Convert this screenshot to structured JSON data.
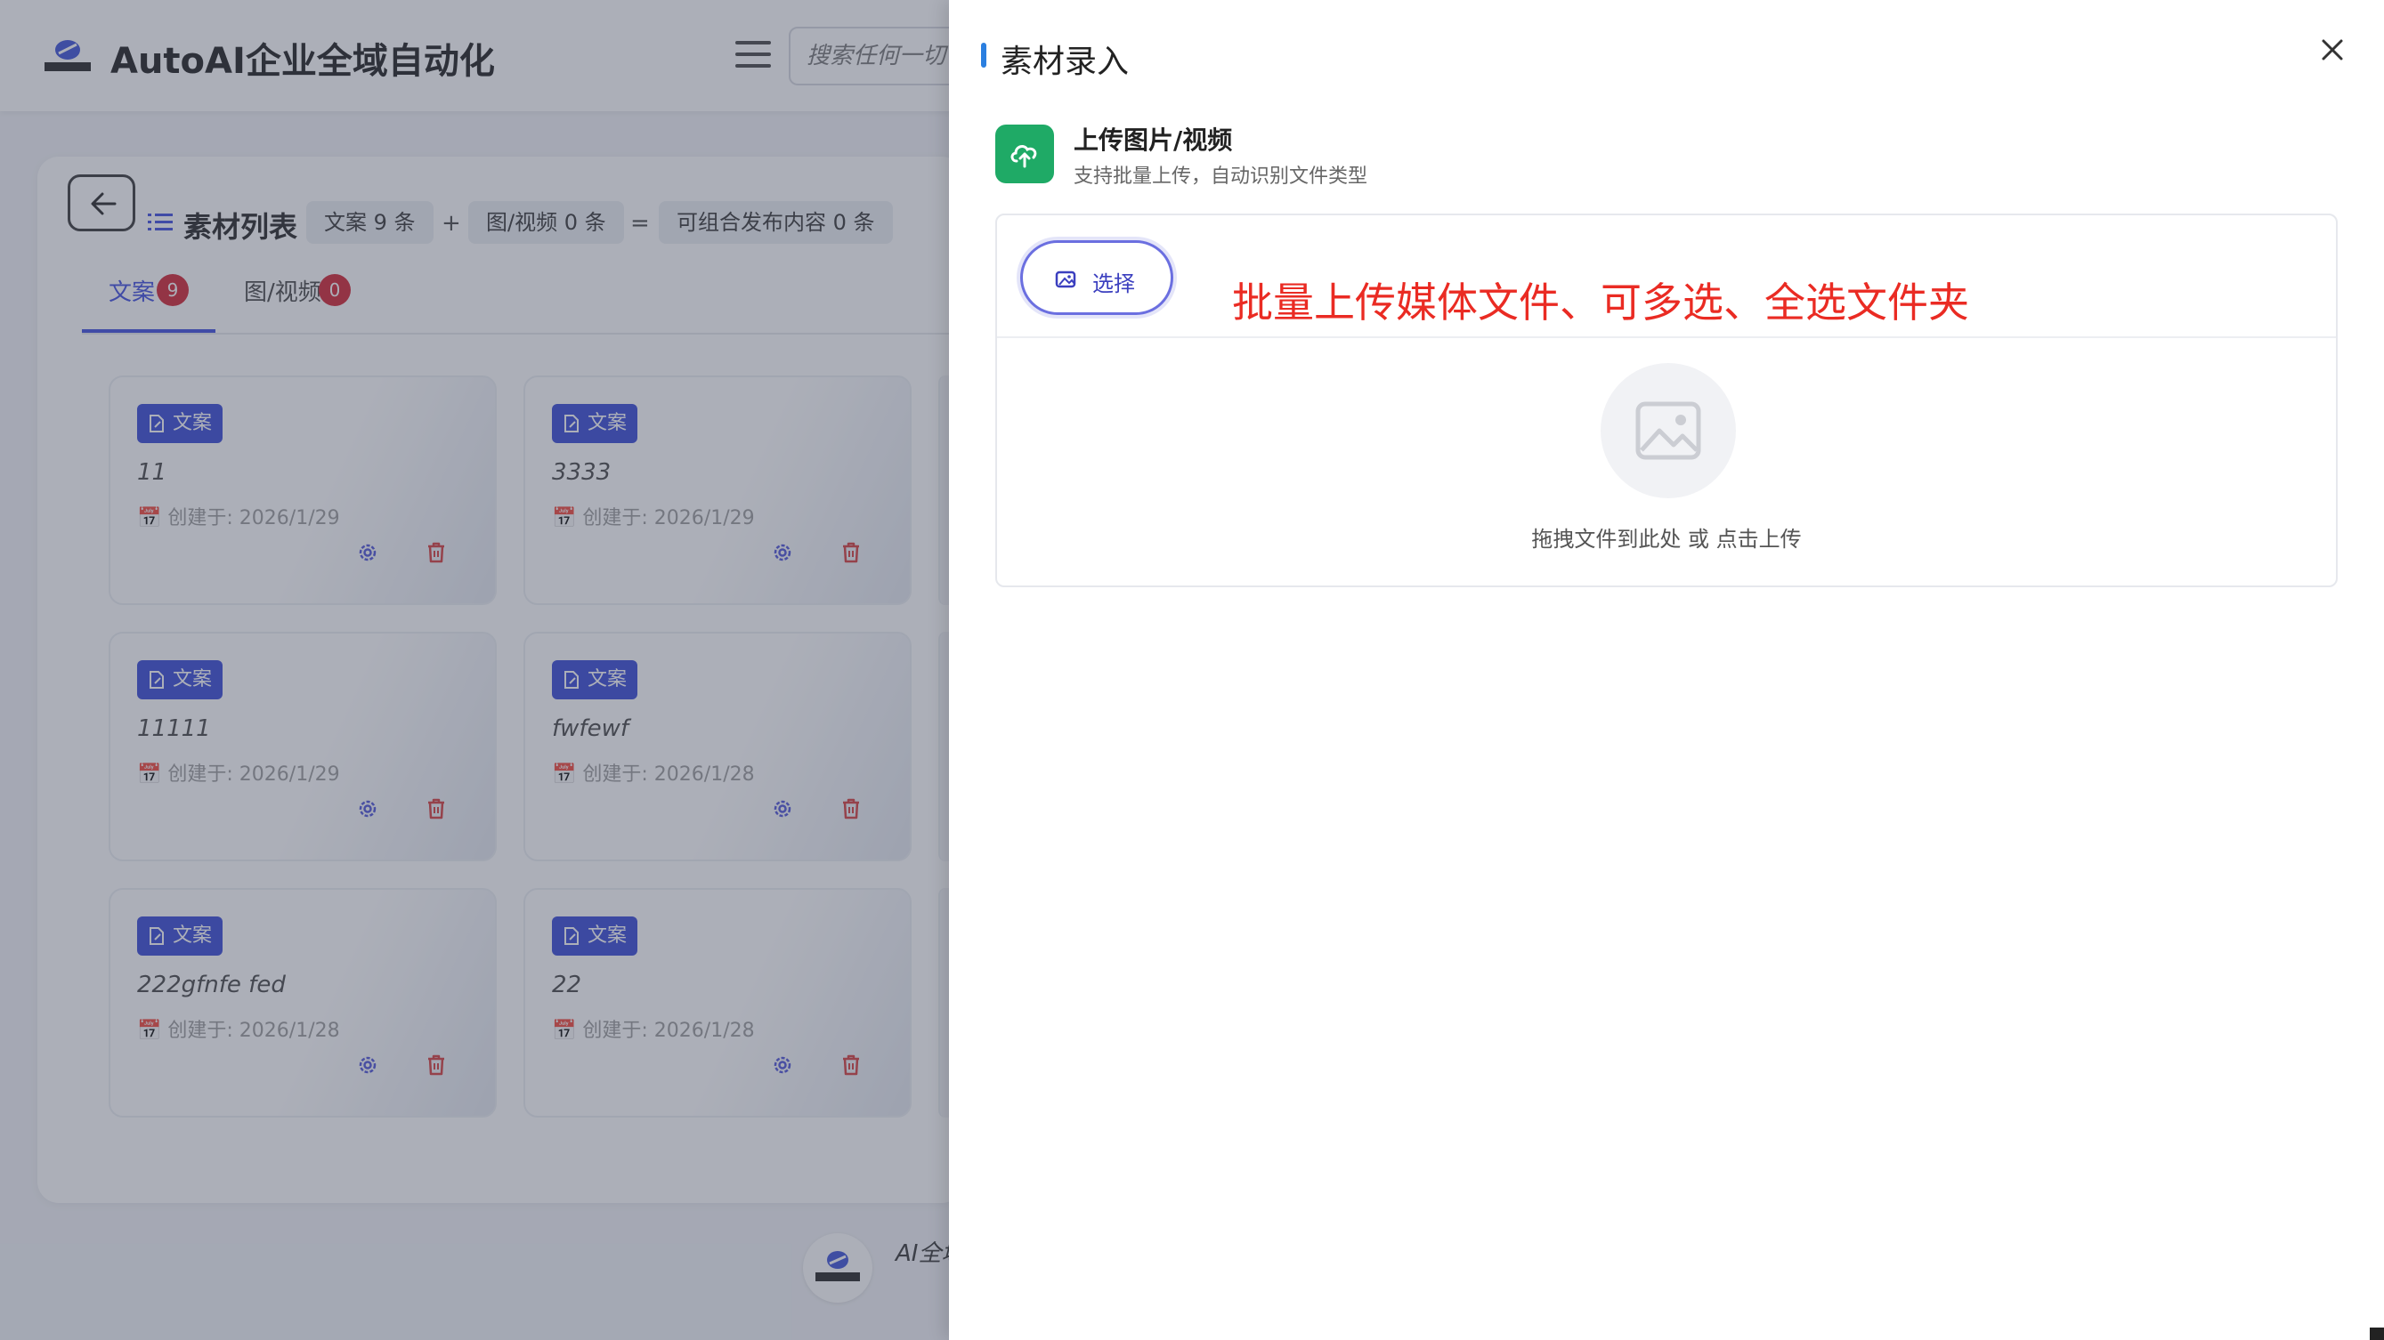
{
  "app": {
    "title": "AutoAI企业全域自动化",
    "search_placeholder": "搜索任何一切",
    "footer_text": "AI全域"
  },
  "list": {
    "title": "素材列表",
    "pill_copy": "文案 9 条",
    "op_plus": "+",
    "pill_media": "图/视频 0 条",
    "op_eq": "=",
    "pill_combo": "可组合发布内容 0 条"
  },
  "tabs": [
    {
      "label": "文案",
      "count": "9"
    },
    {
      "label": "图/视频",
      "count": "0"
    }
  ],
  "cards": [
    {
      "tag": "文案",
      "name": "11",
      "date": "📅 创建于: 2026/1/29"
    },
    {
      "tag": "文案",
      "name": "3333",
      "date": "📅 创建于: 2026/1/29"
    },
    {
      "tag": "文案",
      "name": "11111",
      "date": "📅 创建于: 2026/1/29"
    },
    {
      "tag": "文案",
      "name": "fwfewf",
      "date": "📅 创建于: 2026/1/28"
    },
    {
      "tag": "文案",
      "name": "222gfnfe fed",
      "date": "📅 创建于: 2026/1/28"
    },
    {
      "tag": "文案",
      "name": "22",
      "date": "📅 创建于: 2026/1/28"
    }
  ],
  "drawer": {
    "title": "素材录入",
    "upload_title": "上传图片/视频",
    "upload_sub": "支持批量上传，自动识别文件类型",
    "select_label": "选择",
    "annotation": "批量上传媒体文件、可多选、全选文件夹",
    "drop_hint": "拖拽文件到此处 或 点击上传"
  },
  "colors": {
    "accent": "#3b49df",
    "tag_bg": "#3346d6",
    "badge": "#d21f2f",
    "upload_green": "#1faa66",
    "annotation_red": "#ea2b23",
    "title_bar_blue": "#2b7fe0"
  },
  "icons": [
    "logo-icon",
    "menu-icon",
    "back-arrow-icon",
    "list-icon",
    "edit-doc-icon",
    "gear-icon",
    "trash-icon",
    "close-icon",
    "cloud-upload-icon",
    "image-icon",
    "image-placeholder-icon"
  ]
}
